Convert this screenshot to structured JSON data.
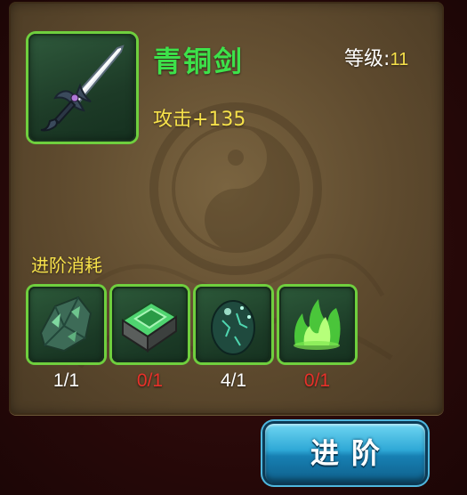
{
  "item": {
    "name": "青铜剑",
    "icon": "sword-icon",
    "level_label": "等级",
    "level_separator": ":",
    "level_value": "11",
    "attack_text": "攻击+135"
  },
  "upgrade_cost": {
    "label": "进阶消耗",
    "materials": [
      {
        "icon": "green-ore-icon",
        "count": "1/1",
        "count_color": "#ffffff"
      },
      {
        "icon": "jade-ingot-icon",
        "count": "0/1",
        "count_color": "#e8312a"
      },
      {
        "icon": "spirit-egg-icon",
        "count": "4/1",
        "count_color": "#ffffff"
      },
      {
        "icon": "green-flame-icon",
        "count": "0/1",
        "count_color": "#e8312a"
      }
    ]
  },
  "advance_button": {
    "label": "进阶"
  },
  "colors": {
    "name_green": "#3de24a",
    "highlight_yellow": "#f6e14a",
    "frame_green": "#6fcf3e",
    "insufficient_red": "#e8312a",
    "button_blue": "#2ea8d6"
  }
}
